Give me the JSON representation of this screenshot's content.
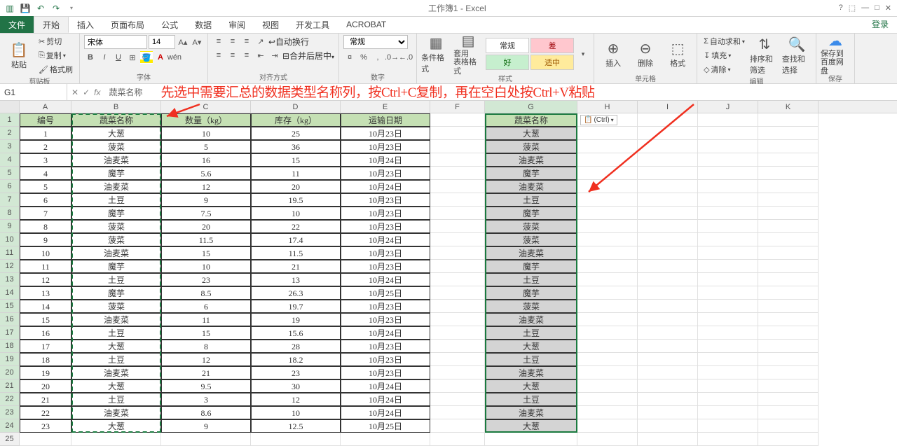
{
  "title": "工作簿1 - Excel",
  "tabs": {
    "file": "文件",
    "home": "开始",
    "insert": "插入",
    "layout": "页面布局",
    "formulas": "公式",
    "data": "数据",
    "review": "审阅",
    "view": "视图",
    "dev": "开发工具",
    "acrobat": "ACROBAT"
  },
  "login": "登录",
  "ribbon": {
    "clipboard": {
      "paste": "粘贴",
      "cut": "剪切",
      "copy": "复制",
      "fmt": "格式刷",
      "label": "剪贴板"
    },
    "font": {
      "name": "宋体",
      "size": "14",
      "label": "字体"
    },
    "align": {
      "wrap": "自动换行",
      "merge": "合并后居中",
      "label": "对齐方式"
    },
    "number": {
      "general": "常规",
      "label": "数字"
    },
    "styles": {
      "condfmt": "条件格式",
      "tablefmt": "套用\n表格格式",
      "normal": "常规",
      "bad": "差",
      "good": "好",
      "neutral": "适中",
      "label": "样式"
    },
    "cells": {
      "insert": "插入",
      "delete": "删除",
      "format": "格式",
      "label": "单元格"
    },
    "editing": {
      "sum": "自动求和",
      "fill": "填充",
      "clear": "清除",
      "sort": "排序和筛选",
      "find": "查找和选择",
      "label": "编辑"
    },
    "save": {
      "btn": "保存到\n百度网盘",
      "label": "保存"
    }
  },
  "namebox": "G1",
  "fxvalue": "蔬菜名称",
  "annotation": "先选中需要汇总的数据类型名称列，按Ctrl+C复制，再在空白处按Ctrl+V粘贴",
  "paste_badge": "(Ctrl)",
  "columns": [
    "A",
    "B",
    "C",
    "D",
    "E",
    "F",
    "G",
    "H",
    "I",
    "J",
    "K"
  ],
  "headers": {
    "A": "编号",
    "B": "蔬菜名称",
    "C": "数量（kg）",
    "D": "库存（kg）",
    "E": "运输日期",
    "G": "蔬菜名称"
  },
  "chart_data": {
    "type": "table",
    "columns": [
      "编号",
      "蔬菜名称",
      "数量（kg）",
      "库存（kg）",
      "运输日期"
    ],
    "rows": [
      [
        "1",
        "大葱",
        "10",
        "25",
        "10月23日"
      ],
      [
        "2",
        "菠菜",
        "5",
        "36",
        "10月23日"
      ],
      [
        "3",
        "油麦菜",
        "16",
        "15",
        "10月24日"
      ],
      [
        "4",
        "魔芋",
        "5.6",
        "11",
        "10月23日"
      ],
      [
        "5",
        "油麦菜",
        "12",
        "20",
        "10月24日"
      ],
      [
        "6",
        "土豆",
        "9",
        "19.5",
        "10月23日"
      ],
      [
        "7",
        "魔芋",
        "7.5",
        "10",
        "10月23日"
      ],
      [
        "8",
        "菠菜",
        "20",
        "22",
        "10月23日"
      ],
      [
        "9",
        "菠菜",
        "11.5",
        "17.4",
        "10月24日"
      ],
      [
        "10",
        "油麦菜",
        "15",
        "11.5",
        "10月23日"
      ],
      [
        "11",
        "魔芋",
        "10",
        "21",
        "10月23日"
      ],
      [
        "12",
        "土豆",
        "23",
        "13",
        "10月24日"
      ],
      [
        "13",
        "魔芋",
        "8.5",
        "26.3",
        "10月25日"
      ],
      [
        "14",
        "菠菜",
        "6",
        "19.7",
        "10月23日"
      ],
      [
        "15",
        "油麦菜",
        "11",
        "19",
        "10月23日"
      ],
      [
        "16",
        "土豆",
        "15",
        "15.6",
        "10月24日"
      ],
      [
        "17",
        "大葱",
        "8",
        "28",
        "10月23日"
      ],
      [
        "18",
        "土豆",
        "12",
        "18.2",
        "10月23日"
      ],
      [
        "19",
        "油麦菜",
        "21",
        "23",
        "10月23日"
      ],
      [
        "20",
        "大葱",
        "9.5",
        "30",
        "10月24日"
      ],
      [
        "21",
        "土豆",
        "3",
        "12",
        "10月24日"
      ],
      [
        "22",
        "油麦菜",
        "8.6",
        "10",
        "10月24日"
      ],
      [
        "23",
        "大葱",
        "9",
        "12.5",
        "10月25日"
      ]
    ]
  }
}
